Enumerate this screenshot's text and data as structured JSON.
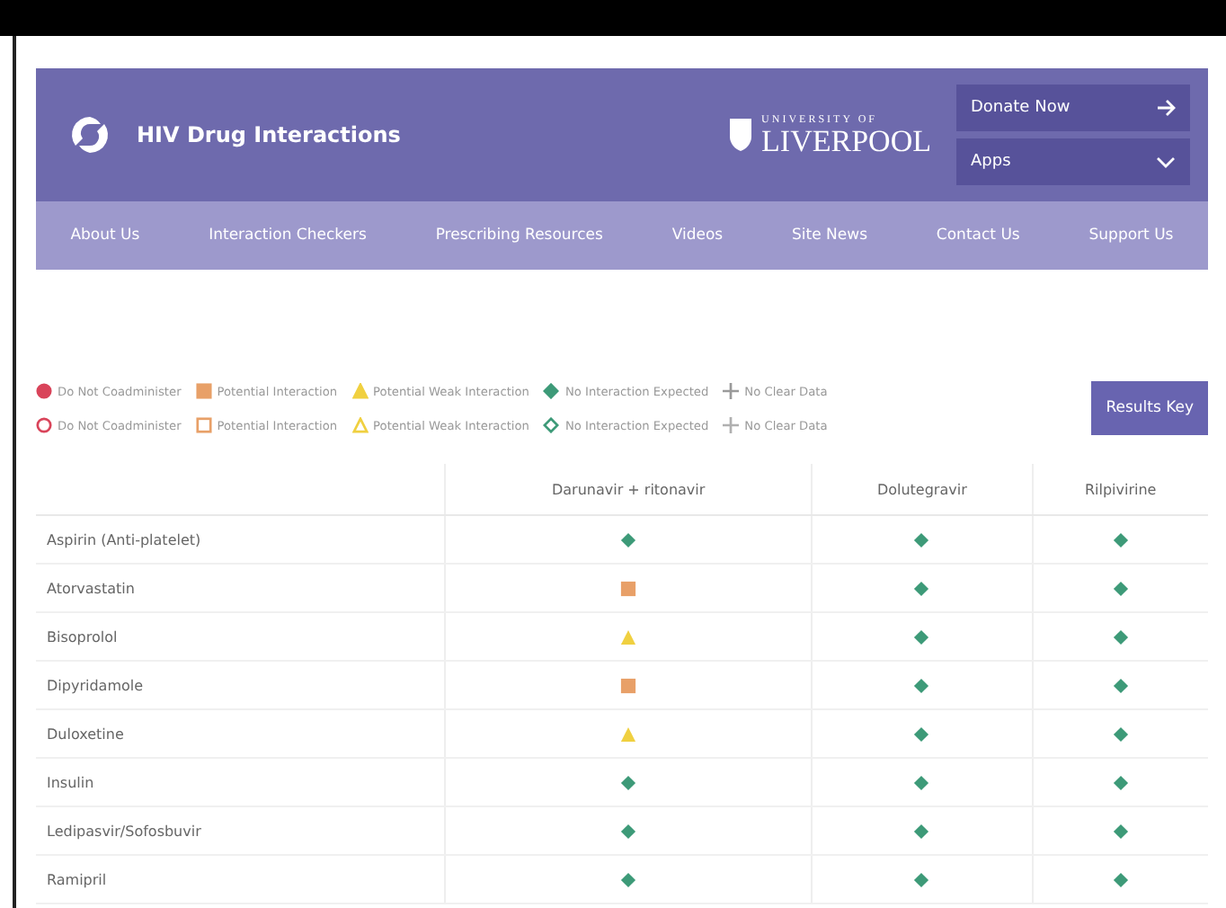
{
  "header": {
    "title": "HIV Drug Interactions",
    "university": {
      "line1": "UNIVERSITY OF",
      "line2": "LIVERPOOL"
    },
    "donate_button": "Donate Now",
    "apps_button": "Apps"
  },
  "nav": [
    "About Us",
    "Interaction Checkers",
    "Prescribing Resources",
    "Videos",
    "Site News",
    "Contact Us",
    "Support Us"
  ],
  "legend": [
    {
      "kind": "filled",
      "items": [
        {
          "kind": "red",
          "label": "Do Not Coadminister"
        },
        {
          "kind": "amber",
          "label": "Potential Interaction"
        },
        {
          "kind": "yellow",
          "label": "Potential Weak Interaction"
        },
        {
          "kind": "green",
          "label": "No Interaction Expected"
        },
        {
          "kind": "grey",
          "label": "No Clear Data"
        }
      ]
    },
    {
      "kind": "outline",
      "items": [
        {
          "kind": "red",
          "label": "Do Not Coadminister"
        },
        {
          "kind": "amber",
          "label": "Potential Interaction"
        },
        {
          "kind": "yellow",
          "label": "Potential Weak Interaction"
        },
        {
          "kind": "green",
          "label": "No Interaction Expected"
        },
        {
          "kind": "grey",
          "label": "No Clear Data"
        }
      ]
    }
  ],
  "results_key_button": "Results Key",
  "table": {
    "columns": [
      "Darunavir + ritonavir",
      "Dolutegravir",
      "Rilpivirine"
    ],
    "rows": [
      {
        "drug": "Aspirin (Anti-platelet)",
        "results": [
          {
            "kind": "green"
          },
          {
            "kind": "green"
          },
          {
            "kind": "green"
          }
        ]
      },
      {
        "drug": "Atorvastatin",
        "results": [
          {
            "kind": "amber"
          },
          {
            "kind": "green"
          },
          {
            "kind": "green"
          }
        ]
      },
      {
        "drug": "Bisoprolol",
        "results": [
          {
            "kind": "yellow"
          },
          {
            "kind": "green"
          },
          {
            "kind": "green"
          }
        ]
      },
      {
        "drug": "Dipyridamole",
        "results": [
          {
            "kind": "amber"
          },
          {
            "kind": "green"
          },
          {
            "kind": "green"
          }
        ]
      },
      {
        "drug": "Duloxetine",
        "results": [
          {
            "kind": "yellow"
          },
          {
            "kind": "green"
          },
          {
            "kind": "green"
          }
        ]
      },
      {
        "drug": "Insulin",
        "results": [
          {
            "kind": "green"
          },
          {
            "kind": "green"
          },
          {
            "kind": "green"
          }
        ]
      },
      {
        "drug": "Ledipasvir/Sofosbuvir",
        "results": [
          {
            "kind": "green"
          },
          {
            "kind": "green"
          },
          {
            "kind": "green"
          }
        ]
      },
      {
        "drug": "Ramipril",
        "results": [
          {
            "kind": "green"
          },
          {
            "kind": "green"
          },
          {
            "kind": "green"
          }
        ]
      }
    ]
  }
}
